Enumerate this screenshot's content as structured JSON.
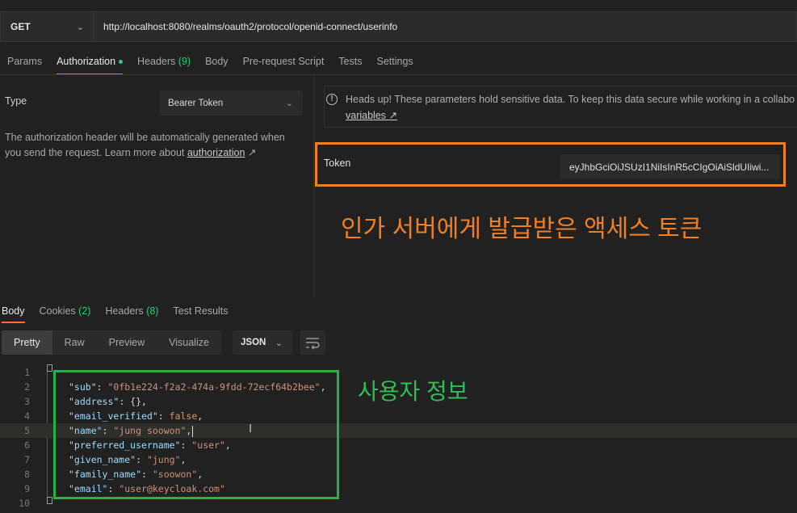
{
  "request": {
    "method": "GET",
    "url": "http://localhost:8080/realms/oauth2/protocol/openid-connect/userinfo"
  },
  "request_tabs": [
    {
      "label": "Params"
    },
    {
      "label": "Authorization"
    },
    {
      "label": "Headers",
      "count": "(9)"
    },
    {
      "label": "Body"
    },
    {
      "label": "Pre-request Script"
    },
    {
      "label": "Tests"
    },
    {
      "label": "Settings"
    }
  ],
  "auth": {
    "type_label": "Type",
    "type_value": "Bearer Token",
    "description": "The authorization header will be automatically generated when you send the request. Learn more about ",
    "description_link": "authorization",
    "notice_text": "Heads up! These parameters hold sensitive data. To keep this data secure while working in a collabo",
    "notice_link": "variables",
    "token_label": "Token",
    "token_value": "eyJhbGciOiJSUzI1NiIsInR5cCIgOiAiSldUIiwi..."
  },
  "annotations": {
    "token_note": "인가 서버에게 발급받은 액세스 토큰",
    "userinfo_note": "사용자 정보"
  },
  "response_tabs": [
    {
      "label": "Body"
    },
    {
      "label": "Cookies",
      "count": "(2)"
    },
    {
      "label": "Headers",
      "count": "(8)"
    },
    {
      "label": "Test Results"
    }
  ],
  "view_modes": [
    "Pretty",
    "Raw",
    "Preview",
    "Visualize"
  ],
  "format": "JSON",
  "code_lines": [
    {
      "n": "1",
      "key": "",
      "val": "",
      "text": "{"
    },
    {
      "n": "2",
      "key": "\"sub\"",
      "val": "\"0fb1e224-f2a2-474a-9fdd-72ecf64b2bee\"",
      "end": ","
    },
    {
      "n": "3",
      "key": "\"address\"",
      "val": "{}",
      "end": ","
    },
    {
      "n": "4",
      "key": "\"email_verified\"",
      "val": "false",
      "end": ","
    },
    {
      "n": "5",
      "key": "\"name\"",
      "val": "\"jung soowon\"",
      "end": ","
    },
    {
      "n": "6",
      "key": "\"preferred_username\"",
      "val": "\"user\"",
      "end": ","
    },
    {
      "n": "7",
      "key": "\"given_name\"",
      "val": "\"jung\"",
      "end": ","
    },
    {
      "n": "8",
      "key": "\"family_name\"",
      "val": "\"soowon\"",
      "end": ","
    },
    {
      "n": "9",
      "key": "\"email\"",
      "val": "\"user@keycloak.com\"",
      "end": ""
    },
    {
      "n": "10",
      "key": "",
      "val": "",
      "text": "}"
    }
  ],
  "colors": {
    "accent": "#ff6c37",
    "token_highlight": "#f07f23",
    "userinfo_highlight": "#27b04a"
  },
  "icons": [
    "chevron-down-icon",
    "info-icon",
    "external-link-icon",
    "wrap-lines-icon",
    "text-cursor-icon"
  ]
}
